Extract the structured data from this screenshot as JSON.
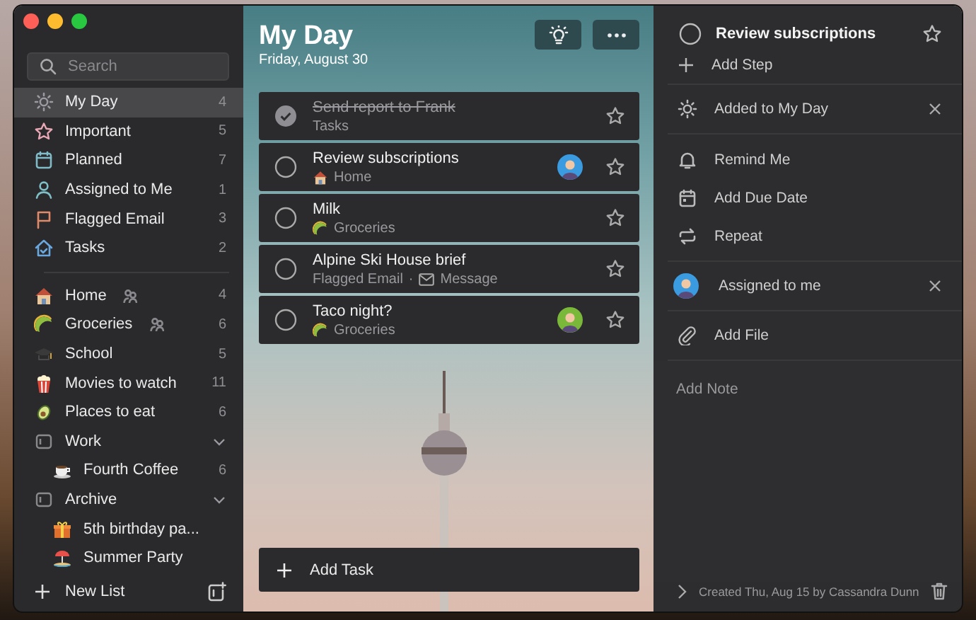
{
  "sidebar": {
    "search": {
      "placeholder": "Search"
    },
    "smart_lists": [
      {
        "label": "My Day",
        "count": "4",
        "selected": true
      },
      {
        "label": "Important",
        "count": "5",
        "selected": false
      },
      {
        "label": "Planned",
        "count": "7",
        "selected": false
      },
      {
        "label": "Assigned to Me",
        "count": "1",
        "selected": false
      },
      {
        "label": "Flagged Email",
        "count": "3",
        "selected": false
      },
      {
        "label": "Tasks",
        "count": "2",
        "selected": false
      }
    ],
    "lists": [
      {
        "kind": "list",
        "label": "Home",
        "shared": true,
        "count": "4",
        "selected": false
      },
      {
        "kind": "list",
        "label": "Groceries",
        "shared": true,
        "count": "6",
        "selected": false
      },
      {
        "kind": "list",
        "label": "School",
        "shared": false,
        "count": "5",
        "selected": false
      },
      {
        "kind": "list",
        "label": "Movies to watch",
        "shared": false,
        "count": "11",
        "selected": false
      },
      {
        "kind": "list",
        "label": "Places to eat",
        "shared": false,
        "count": "6",
        "selected": false
      },
      {
        "kind": "group",
        "label": "Work",
        "expanded": true,
        "children": [
          {
            "label": "Fourth Coffee",
            "count": "6",
            "selected": false
          }
        ]
      },
      {
        "kind": "group",
        "label": "Archive",
        "expanded": true,
        "children": [
          {
            "label": "5th birthday pa...",
            "selected": false
          },
          {
            "label": "Summer Party",
            "selected": false
          }
        ]
      }
    ],
    "new_list": "New List"
  },
  "main": {
    "title": "My Day",
    "date": "Friday, August 30",
    "tasks": [
      {
        "title": "Send report to Frank",
        "done": true,
        "list": "Tasks",
        "assigned": false,
        "starred": false
      },
      {
        "title": "Review subscriptions",
        "done": false,
        "list": "Home",
        "assigned": true,
        "starred": false
      },
      {
        "title": "Milk",
        "done": false,
        "list": "Groceries",
        "assigned": false,
        "starred": false
      },
      {
        "title": "Alpine Ski House brief",
        "done": false,
        "list": "Flagged Email",
        "separator": "·",
        "note": "Message",
        "assigned": false,
        "starred": false
      },
      {
        "title": "Taco night?",
        "done": false,
        "list": "Groceries",
        "assigned": true,
        "starred": false
      }
    ],
    "add_task": "Add Task"
  },
  "detail": {
    "title": "Review subscriptions",
    "done": false,
    "starred": false,
    "groups": [
      [
        {
          "kind": "step",
          "label": "Add Step",
          "removable": false
        }
      ],
      [
        {
          "kind": "my_day",
          "label": "Added to My Day",
          "removable": true
        }
      ],
      [
        {
          "kind": "remind",
          "label": "Remind Me",
          "removable": false
        },
        {
          "kind": "due",
          "label": "Add Due Date",
          "removable": false
        },
        {
          "kind": "repeat",
          "label": "Repeat",
          "removable": false
        }
      ],
      [
        {
          "kind": "assignee",
          "label": "Assigned to me",
          "removable": true
        }
      ],
      [
        {
          "kind": "file",
          "label": "Add File",
          "removable": false
        }
      ]
    ],
    "note": {
      "placeholder": "Add Note"
    },
    "footer": "Created Thu, Aug 15 by Cassandra Dunn"
  }
}
